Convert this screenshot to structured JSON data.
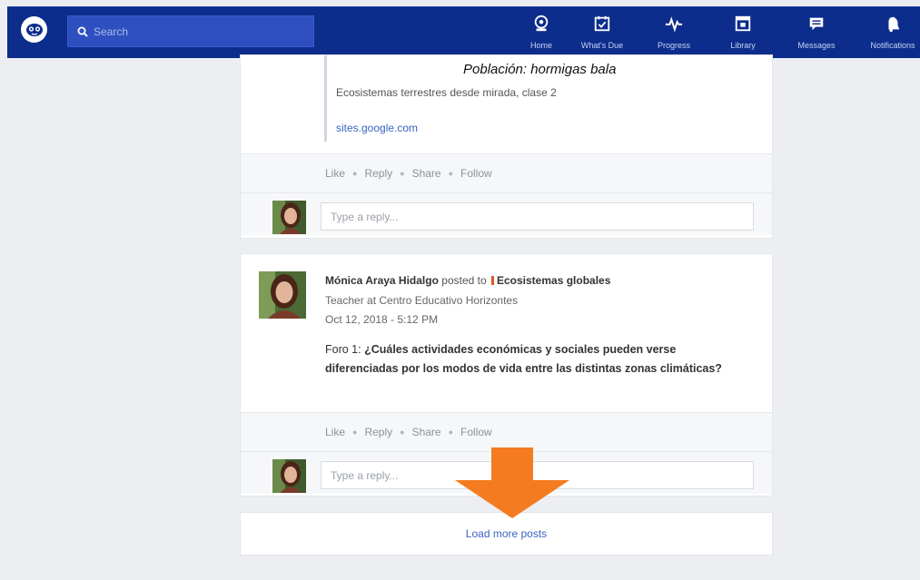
{
  "topbar": {
    "search_placeholder": "Search",
    "nav": [
      {
        "label": "Home",
        "icon": "home-icon"
      },
      {
        "label": "What's Due",
        "icon": "calendar-check-icon"
      },
      {
        "label": "Progress",
        "icon": "pulse-icon"
      },
      {
        "label": "Library",
        "icon": "library-icon"
      },
      {
        "label": "Messages",
        "icon": "message-icon"
      },
      {
        "label": "Notifications",
        "icon": "bell-icon"
      }
    ],
    "colors": {
      "bar": "#0d2d8c",
      "search": "#2d4fc0"
    }
  },
  "post1": {
    "preview_title": "Población: hormigas bala",
    "preview_desc": "Ecosistemas terrestres desde mirada, clase 2",
    "preview_url": "sites.google.com",
    "actions": [
      "Like",
      "Reply",
      "Share",
      "Follow"
    ],
    "reply_placeholder": "Type a reply..."
  },
  "post2": {
    "author": "Mónica Araya Hidalgo",
    "posted_to": "posted to",
    "group": "Ecosistemas globales",
    "role": "Teacher at Centro Educativo Horizontes",
    "timestamp": "Oct 12, 2018 - 5:12 PM",
    "body_prefix": "Foro 1: ",
    "body_question": "¿Cuáles actividades económicas y sociales pueden verse diferenciadas por los modos de vida entre las distintas zonas climáticas?",
    "actions": [
      "Like",
      "Reply",
      "Share",
      "Follow"
    ],
    "reply_placeholder": "Type a reply..."
  },
  "load_more": "Load more posts",
  "annotation_color": "#f47b20"
}
